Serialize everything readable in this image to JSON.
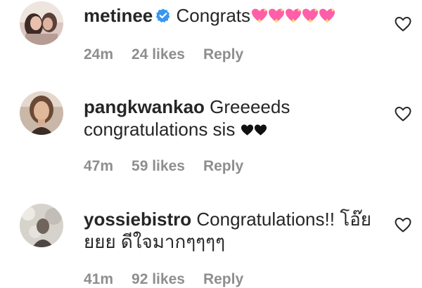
{
  "comments": [
    {
      "username": "metinee",
      "verified": true,
      "text": "Congrats",
      "emoji": [
        "sparkling-heart",
        "sparkling-heart",
        "sparkling-heart",
        "sparkling-heart",
        "sparkling-heart"
      ],
      "time": "24m",
      "likes": "24 likes",
      "reply": "Reply"
    },
    {
      "username": "pangkwankao",
      "verified": false,
      "text": "Greeeeds congratulations sis",
      "emoji": [
        "black-heart",
        "black-heart"
      ],
      "time": "47m",
      "likes": "59 likes",
      "reply": "Reply"
    },
    {
      "username": "yossiebistro",
      "verified": false,
      "text": "Congratulations!! โอ๊ย ยยย ดีใจมากๆๆๆๆ",
      "emoji": [],
      "time": "41m",
      "likes": "92 likes",
      "reply": "Reply"
    }
  ],
  "colors": {
    "text": "#262626",
    "meta": "#8e8e8e",
    "verified_badge": "#3897f0",
    "emoji_heart": "#ff5fa8",
    "heart_outline": "#262626"
  }
}
